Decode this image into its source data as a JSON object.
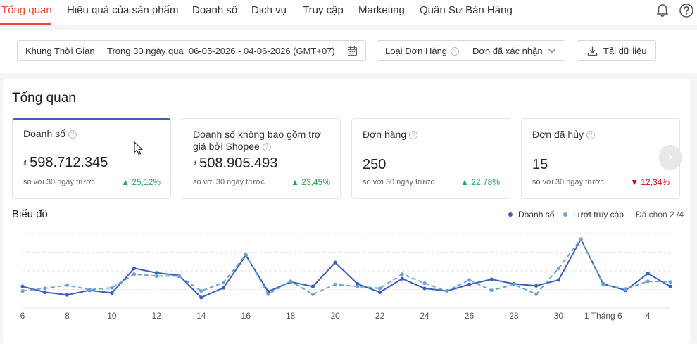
{
  "nav": {
    "tabs": [
      {
        "label": "Tổng quan",
        "active": true
      },
      {
        "label": "Hiệu quả của sản phẩm"
      },
      {
        "label": "Doanh số"
      },
      {
        "label": "Dịch vụ"
      },
      {
        "label": "Truy cập"
      },
      {
        "label": "Marketing"
      },
      {
        "label": "Quân Sư Bán Hàng"
      }
    ],
    "accent": "#ee4d2d",
    "icons": [
      "bell-icon",
      "help-icon"
    ]
  },
  "filters": {
    "time_frame_label": "Khung Thời Gian",
    "time_frame_value": "Trong 30 ngày qua",
    "date_range": "06-05-2026 - 04-06-2026 (GMT+07)",
    "order_type_label": "Loại Đơn Hàng",
    "order_type_value": "Đơn đã xác nhận",
    "download_label": "Tải dữ liệu"
  },
  "overview": {
    "title": "Tổng quan",
    "metrics": [
      {
        "label": "Doanh số",
        "currency": "₫",
        "value": "598.712.345",
        "compare": "so với 30 ngày trước",
        "change": "25,12%",
        "direction": "up"
      },
      {
        "label": "Doanh số không bao gồm trợ giá bởi Shopee",
        "currency": "₫",
        "value": "508.905.493",
        "compare": "so với 30 ngày trước",
        "change": "23,45%",
        "direction": "up"
      },
      {
        "label": "Đơn hàng",
        "currency": "",
        "value": "250",
        "compare": "so với 30 ngày trước",
        "change": "22,78%",
        "direction": "up"
      },
      {
        "label": "Đơn đã hủy",
        "currency": "",
        "value": "15",
        "compare": "so với 30 ngày trước",
        "change": "12,34%",
        "direction": "down"
      }
    ]
  },
  "chart_section": {
    "title": "Biểu đồ",
    "legend": [
      {
        "label": "Doanh số",
        "color": "#3b5fb8"
      },
      {
        "label": "Lượt truy cập",
        "color": "#6ba3d8"
      }
    ],
    "selected_label": "Đã chọn 2 /4"
  },
  "chart_data": {
    "type": "line",
    "x": [
      "6",
      "7",
      "8",
      "9",
      "10",
      "11",
      "12",
      "13",
      "14",
      "15",
      "16",
      "17",
      "18",
      "19",
      "20",
      "21",
      "22",
      "23",
      "24",
      "25",
      "26",
      "27",
      "28",
      "29",
      "30",
      "31",
      "1 Tháng 6",
      "2",
      "3",
      "4"
    ],
    "tick_labels": [
      "6",
      "8",
      "10",
      "12",
      "14",
      "16",
      "18",
      "20",
      "22",
      "24",
      "26",
      "28",
      "30",
      "1 Tháng 6",
      "4"
    ],
    "series": [
      {
        "name": "Doanh số",
        "style": "solid",
        "color": "#3b5fb8",
        "values": [
          0.27,
          0.18,
          0.14,
          0.21,
          0.17,
          0.55,
          0.48,
          0.44,
          0.1,
          0.25,
          0.75,
          0.19,
          0.34,
          0.27,
          0.64,
          0.31,
          0.18,
          0.39,
          0.24,
          0.2,
          0.3,
          0.38,
          0.31,
          0.28,
          0.37,
          1.0,
          0.31,
          0.21,
          0.47,
          0.27
        ]
      },
      {
        "name": "Lượt truy cập",
        "style": "dashed",
        "color": "#6ba3d8",
        "values": [
          0.2,
          0.24,
          0.29,
          0.22,
          0.25,
          0.46,
          0.43,
          0.43,
          0.2,
          0.33,
          0.76,
          0.15,
          0.35,
          0.15,
          0.3,
          0.27,
          0.24,
          0.46,
          0.32,
          0.2,
          0.37,
          0.21,
          0.3,
          0.15,
          0.55,
          1.0,
          0.3,
          0.23,
          0.35,
          0.34
        ]
      }
    ],
    "y_axis_labels": false,
    "grid": true
  }
}
